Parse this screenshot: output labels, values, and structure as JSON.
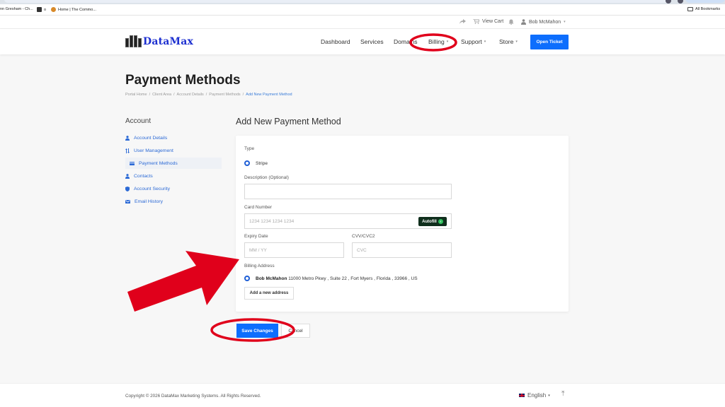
{
  "bookmarks": {
    "items": [
      "nn Gresham - Ch...",
      "o",
      "Home | The Commo..."
    ],
    "all_bookmarks": "All Bookmarks"
  },
  "topbar": {
    "view_cart": "View Cart",
    "user_name": "Bob McMahon"
  },
  "navbar": {
    "logo_text": "DataMax",
    "items": [
      "Dashboard",
      "Services",
      "Domains",
      "Billing",
      "Support",
      "Store"
    ],
    "open_ticket": "Open Ticket"
  },
  "page": {
    "title": "Payment Methods",
    "breadcrumb": [
      "Portal Home",
      "Client Area",
      "Account Details",
      "Payment Methods",
      "Add New Payment Method"
    ]
  },
  "sidebar": {
    "title": "Account",
    "items": [
      {
        "label": "Account Details",
        "icon": "user-icon"
      },
      {
        "label": "User Management",
        "icon": "sort-icon"
      },
      {
        "label": "Payment Methods",
        "icon": "card-icon",
        "active": true
      },
      {
        "label": "Contacts",
        "icon": "user-icon"
      },
      {
        "label": "Account Security",
        "icon": "shield-icon"
      },
      {
        "label": "Email History",
        "icon": "envelope-icon"
      }
    ]
  },
  "form": {
    "heading": "Add New Payment Method",
    "type_label": "Type",
    "type_option": "Stripe",
    "description_label": "Description (Optional)",
    "description_value": "",
    "card_number_label": "Card Number",
    "card_number_placeholder": "1234 1234 1234 1234",
    "autofill": "Autofill",
    "expiry_label": "Expiry Date",
    "expiry_placeholder": "MM / YY",
    "cvv_label": "CVV/CVC2",
    "cvv_placeholder": "CVC",
    "billing_label": "Billing Address",
    "billing_name": "Bob McMahon",
    "billing_address": "11000 Metro Pkwy , Suite 22 , Fort Myers , Florida , 33966 , US",
    "add_address": "Add a new address",
    "save": "Save Changes",
    "cancel": "Cancel"
  },
  "footer": {
    "copyright": "Copyright © 2026 DataMax Marketing Systems. All Rights Reserved.",
    "language": "English"
  },
  "colors": {
    "primary": "#0d6efd",
    "link": "#2c6ad6",
    "annotation": "#e0001b"
  }
}
